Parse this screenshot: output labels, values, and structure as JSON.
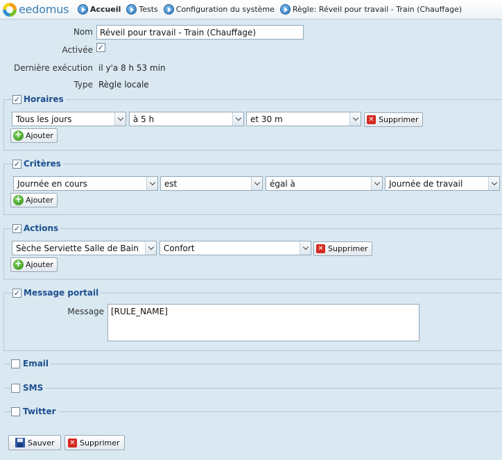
{
  "header": {
    "logo_text": "eedomus",
    "breadcrumbs": [
      {
        "label": "Accueil"
      },
      {
        "label": "Tests"
      },
      {
        "label": "Configuration du système"
      },
      {
        "label": "Règle: Réveil pour travail - Train (Chauffage)"
      }
    ]
  },
  "rule": {
    "name_label": "Nom",
    "name_value": "Réveil pour travail - Train (Chauffage)",
    "active_label": "Activée",
    "active_checked": true,
    "last_run_label": "Dernière exécution",
    "last_run_value": "il y'a 8 h 53 min",
    "type_label": "Type",
    "type_value": "Règle locale"
  },
  "horaires": {
    "title": "Horaires",
    "checked": true,
    "day": "Tous les jours",
    "hour": "à 5 h",
    "minute": "et 30 m",
    "delete_label": "Supprimer",
    "add_label": "Ajouter"
  },
  "criteres": {
    "title": "Critères",
    "checked": true,
    "subject": "Journée en cours",
    "verb": "est",
    "operator": "égal à",
    "value": "Journée de travail",
    "add_label": "Ajouter"
  },
  "actions": {
    "title": "Actions",
    "checked": true,
    "device": "Sèche Serviette Salle de Bain",
    "value": "Confort",
    "delete_label": "Supprimer",
    "add_label": "Ajouter"
  },
  "message_portail": {
    "title": "Message portail",
    "checked": true,
    "message_label": "Message",
    "message_value": "[RULE_NAME]"
  },
  "email": {
    "title": "Email",
    "checked": false
  },
  "sms": {
    "title": "SMS",
    "checked": false
  },
  "twitter": {
    "title": "Twitter",
    "checked": false
  },
  "footer": {
    "save_label": "Sauver",
    "delete_label": "Supprimer"
  }
}
